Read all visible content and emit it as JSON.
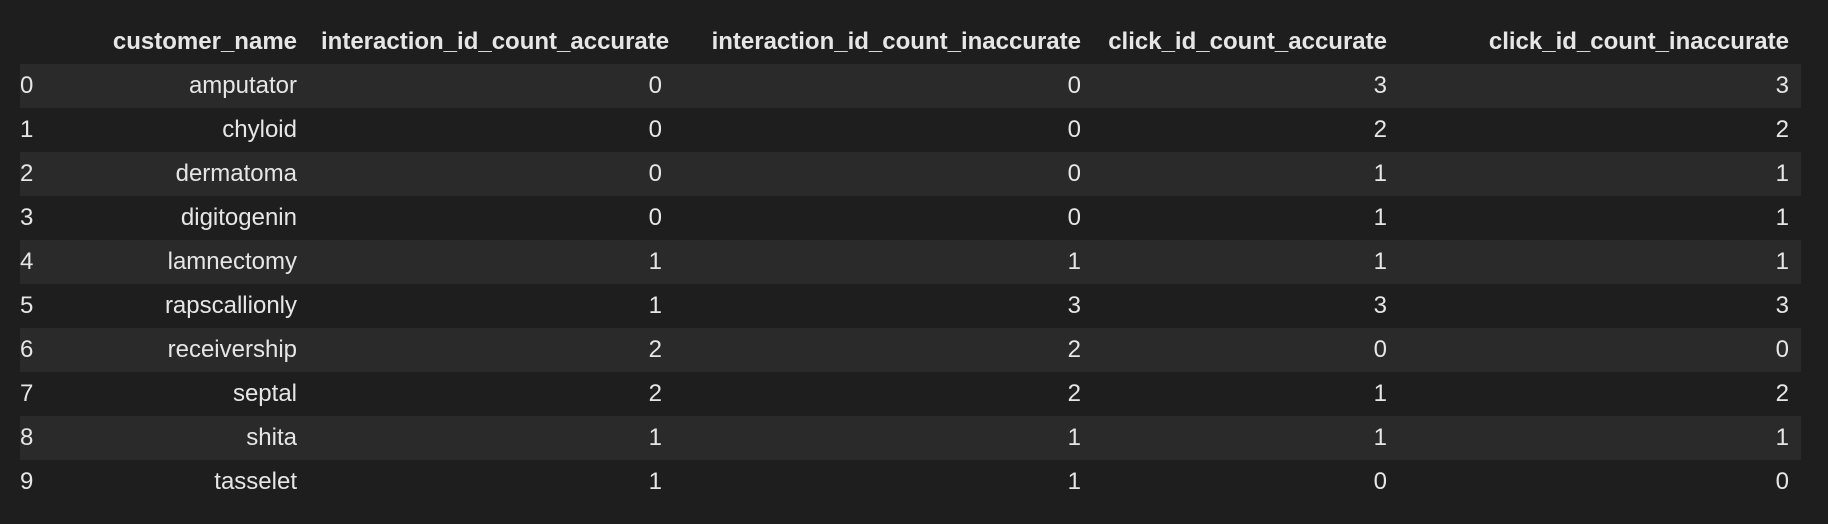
{
  "table": {
    "index_header": "",
    "columns": [
      "customer_name",
      "interaction_id_count_accurate",
      "interaction_id_count_inaccurate",
      "click_id_count_accurate",
      "click_id_count_inaccurate"
    ],
    "rows": [
      {
        "index": "0",
        "cells": [
          "amputator",
          "0",
          "0",
          "3",
          "3"
        ]
      },
      {
        "index": "1",
        "cells": [
          "chyloid",
          "0",
          "0",
          "2",
          "2"
        ]
      },
      {
        "index": "2",
        "cells": [
          "dermatoma",
          "0",
          "0",
          "1",
          "1"
        ]
      },
      {
        "index": "3",
        "cells": [
          "digitogenin",
          "0",
          "0",
          "1",
          "1"
        ]
      },
      {
        "index": "4",
        "cells": [
          "lamnectomy",
          "1",
          "1",
          "1",
          "1"
        ]
      },
      {
        "index": "5",
        "cells": [
          "rapscallionly",
          "1",
          "3",
          "3",
          "3"
        ]
      },
      {
        "index": "6",
        "cells": [
          "receivership",
          "2",
          "2",
          "0",
          "0"
        ]
      },
      {
        "index": "7",
        "cells": [
          "septal",
          "2",
          "2",
          "1",
          "2"
        ]
      },
      {
        "index": "8",
        "cells": [
          "shita",
          "1",
          "1",
          "1",
          "1"
        ]
      },
      {
        "index": "9",
        "cells": [
          "tasselet",
          "1",
          "1",
          "0",
          "0"
        ]
      }
    ]
  },
  "colors": {
    "background": "#1e1e1e",
    "row_odd": "#2a2a2a",
    "text": "#e6e6e6"
  }
}
